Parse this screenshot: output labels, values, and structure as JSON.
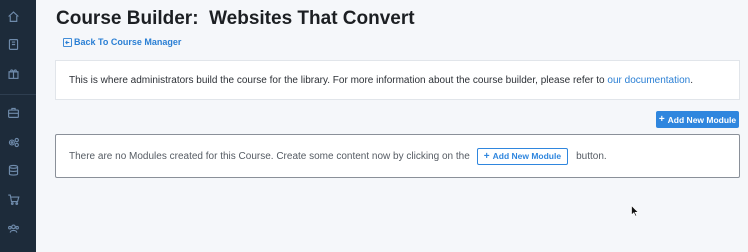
{
  "sidebar": {
    "items": [
      {
        "icon": "home-icon"
      },
      {
        "icon": "book-icon"
      },
      {
        "icon": "gift-icon"
      },
      {
        "icon": "briefcase-icon"
      },
      {
        "icon": "settings-icon"
      },
      {
        "icon": "database-icon"
      },
      {
        "icon": "cart-icon"
      },
      {
        "icon": "users-icon"
      }
    ]
  },
  "header": {
    "title": "Course Builder:  Websites That Convert",
    "back_link": "Back To Course Manager"
  },
  "info": {
    "text": "This is where administrators build the course for the library. For more information about the course builder, please refer to ",
    "link": "our documentation",
    "suffix": "."
  },
  "actions": {
    "add_module_label": "Add New Module"
  },
  "empty_state": {
    "text_before": "There are no Modules created for this Course. Create some content now by clicking on the",
    "button_label": "Add New Module",
    "text_after": "button."
  },
  "colors": {
    "sidebar": "#1d2b3a",
    "accent": "#2f86de",
    "link": "#2a7fd4",
    "background": "#f5f7fa"
  }
}
